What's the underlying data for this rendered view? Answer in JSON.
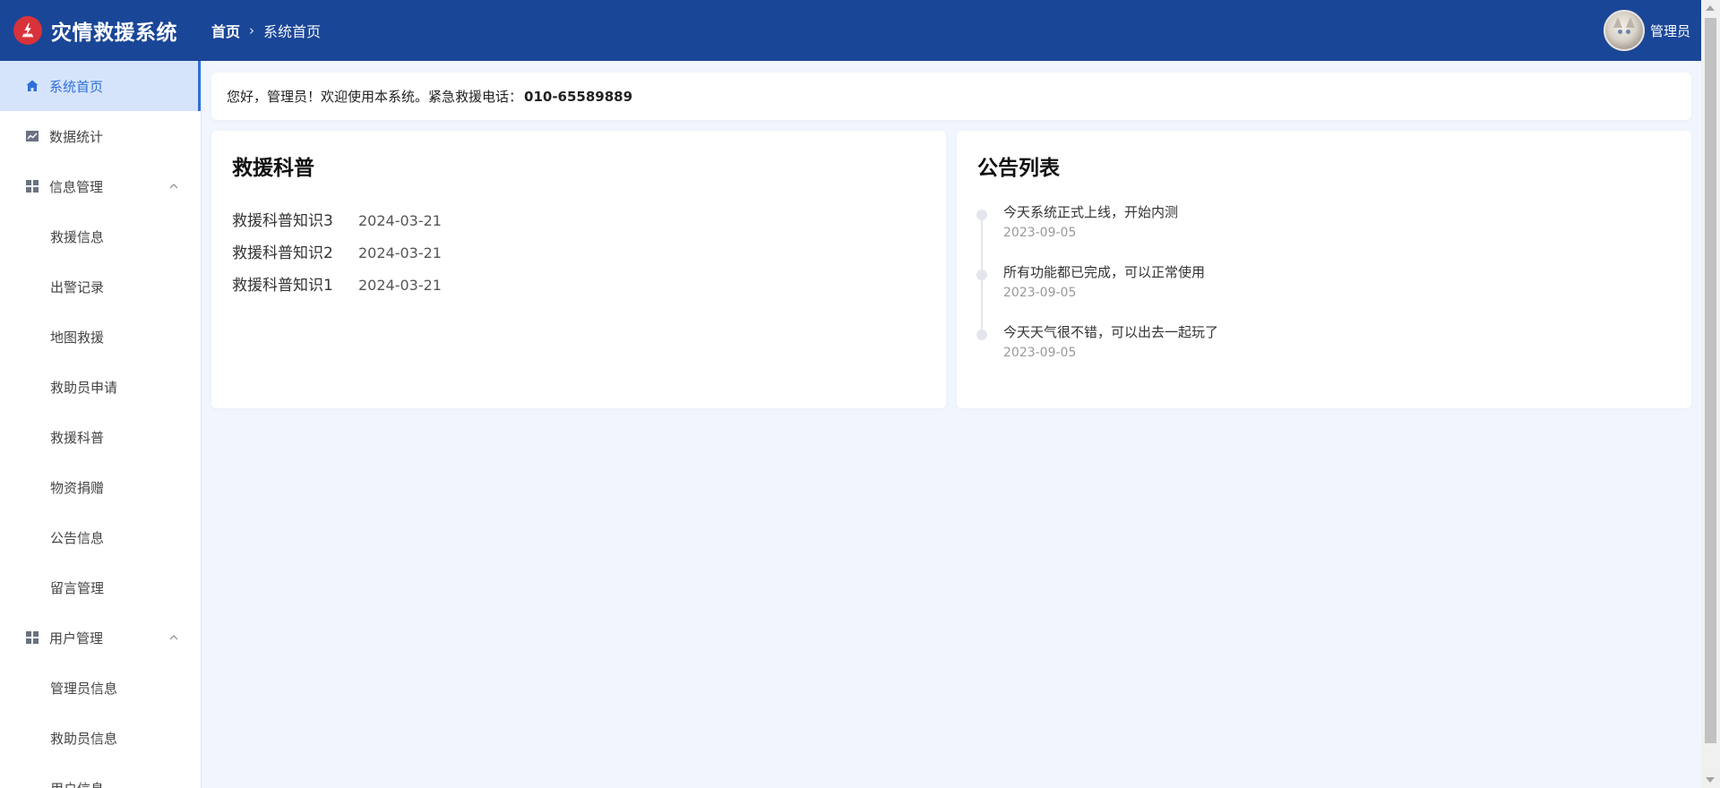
{
  "header": {
    "app_title": "灾情救援系统",
    "breadcrumb": {
      "home": "首页",
      "separator": "›",
      "current": "系统首页"
    },
    "user_name": "管理员"
  },
  "sidebar": {
    "items": [
      {
        "label": "系统首页",
        "icon": "home-icon",
        "active": true
      },
      {
        "label": "数据统计",
        "icon": "chart-icon"
      },
      {
        "label": "信息管理",
        "icon": "grid-icon",
        "expanded": true,
        "children": [
          "救援信息",
          "出警记录",
          "地图救援",
          "救助员申请",
          "救援科普",
          "物资捐赠",
          "公告信息",
          "留言管理"
        ]
      },
      {
        "label": "用户管理",
        "icon": "grid-icon",
        "expanded": true,
        "children": [
          "管理员信息",
          "救助员信息",
          "用户信息"
        ]
      }
    ]
  },
  "welcome": {
    "text": "您好，管理员！欢迎使用本系统。紧急救援电话：",
    "phone": "010-65589889"
  },
  "science": {
    "title": "救援科普",
    "items": [
      {
        "title": "救援科普知识3",
        "date": "2024-03-21"
      },
      {
        "title": "救援科普知识2",
        "date": "2024-03-21"
      },
      {
        "title": "救援科普知识1",
        "date": "2024-03-21"
      }
    ]
  },
  "notices": {
    "title": "公告列表",
    "items": [
      {
        "content": "今天系统正式上线，开始内测",
        "date": "2023-09-05"
      },
      {
        "content": "所有功能都已完成，可以正常使用",
        "date": "2023-09-05"
      },
      {
        "content": "今天天气很不错，可以出去一起玩了",
        "date": "2023-09-05"
      }
    ]
  },
  "colors": {
    "header_bg": "#1a4698",
    "accent": "#2e6fd8",
    "active_bg": "#d6e4fb",
    "page_bg": "#f1f5fd",
    "logo_red": "#d8323a"
  }
}
